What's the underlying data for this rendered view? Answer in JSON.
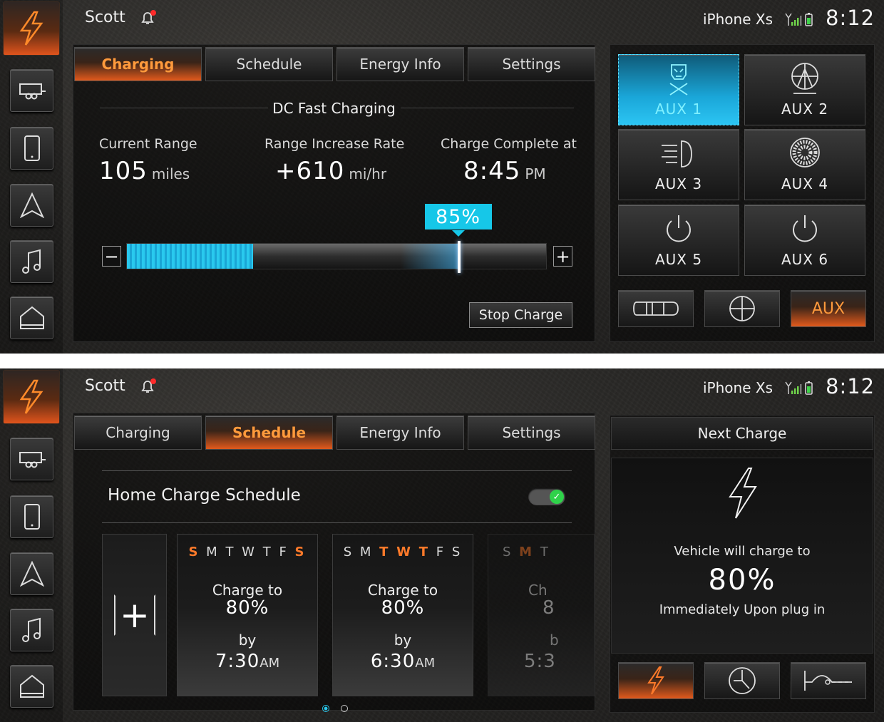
{
  "status": {
    "user": "Scott",
    "device": "iPhone Xs",
    "time": "8:12"
  },
  "tabs": [
    {
      "label": "Charging"
    },
    {
      "label": "Schedule"
    },
    {
      "label": "Energy Info"
    },
    {
      "label": "Settings"
    }
  ],
  "charging": {
    "title": "DC Fast Charging",
    "current_range_label": "Current Range",
    "current_range_value": "105",
    "current_range_unit": "miles",
    "rate_label": "Range Increase Rate",
    "rate_value": "+610",
    "rate_unit": "mi/hr",
    "complete_label": "Charge Complete at",
    "complete_value": "8:45",
    "complete_unit": "PM",
    "current_level_fraction": 0.3,
    "target_percent": 85,
    "target_label": "85%",
    "minus": "−",
    "plus": "+",
    "stop_label": "Stop Charge"
  },
  "aux": [
    {
      "label": "AUX 1",
      "icon": "light-bar-icon",
      "on": true
    },
    {
      "label": "AUX 2",
      "icon": "spotlight-icon",
      "on": false
    },
    {
      "label": "AUX 3",
      "icon": "headlight-icon",
      "on": false
    },
    {
      "label": "AUX 4",
      "icon": "grille-light-icon",
      "on": false
    },
    {
      "label": "AUX 5",
      "icon": "power-icon",
      "on": false
    },
    {
      "label": "AUX 6",
      "icon": "power-icon",
      "on": false
    }
  ],
  "aux_bottom": {
    "aux_label": "AUX"
  },
  "schedule": {
    "title": "Home Charge Schedule",
    "enabled": true,
    "add_label": "+",
    "cards": [
      {
        "days": [
          "S",
          "M",
          "T",
          "W",
          "T",
          "F",
          "S"
        ],
        "highlight": [
          0,
          6
        ],
        "charge_label": "Charge to",
        "percent": "80%",
        "by_label": "by",
        "time": "7:30",
        "ampm": "AM"
      },
      {
        "days": [
          "S",
          "M",
          "T",
          "W",
          "T",
          "F",
          "S"
        ],
        "highlight": [
          2,
          3,
          4
        ],
        "charge_label": "Charge to",
        "percent": "80%",
        "by_label": "by",
        "time": "6:30",
        "ampm": "AM"
      },
      {
        "days": [
          "S",
          "M",
          "T"
        ],
        "highlight": [
          1
        ],
        "charge_label": "Ch",
        "percent": "8",
        "by_label": "b",
        "time": "5:3",
        "ampm": ""
      }
    ]
  },
  "next_charge": {
    "title": "Next Charge",
    "line1": "Vehicle will charge to",
    "percent": "80%",
    "line2": "Immediately Upon plug in"
  },
  "colors": {
    "accent_orange": "#e25a1c",
    "accent_cyan": "#16c7e8",
    "toggle_green": "#2fd24a"
  }
}
